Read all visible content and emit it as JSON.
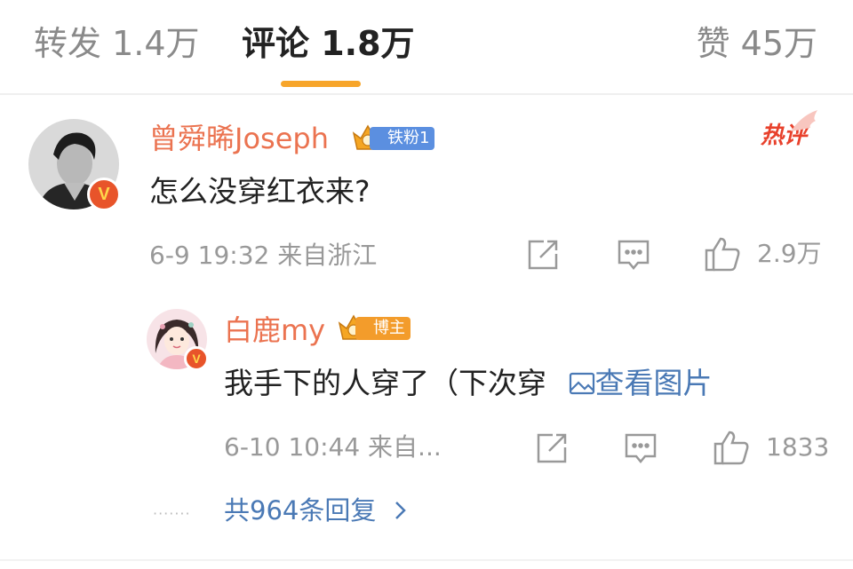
{
  "tabs": {
    "repost": "转发 1.4万",
    "comments": "评论 1.8万",
    "likes": "赞 45万"
  },
  "colors": {
    "accent": "#f7a52a",
    "username": "#eb7350",
    "link": "#4a79b5",
    "hot": "#e8412c"
  },
  "comment": {
    "username": "曾舜晞Joseph",
    "badge": "铁粉1",
    "tag": "热评",
    "text": "怎么没穿红衣来?",
    "meta": "6-9 19:32  来自浙江",
    "like_count": "2.9万",
    "verified_mark": "V",
    "icons": [
      "share-icon",
      "comment-icon",
      "like-icon"
    ]
  },
  "reply": {
    "username": "白鹿my",
    "badge": "博主",
    "text": "我手下的人穿了（下次穿",
    "view_image": "查看图片",
    "meta": "6-10 10:44  来自...",
    "like_count": "1833",
    "verified_mark": "V"
  },
  "more_replies": "共964条回复",
  "more_dots": "·······"
}
